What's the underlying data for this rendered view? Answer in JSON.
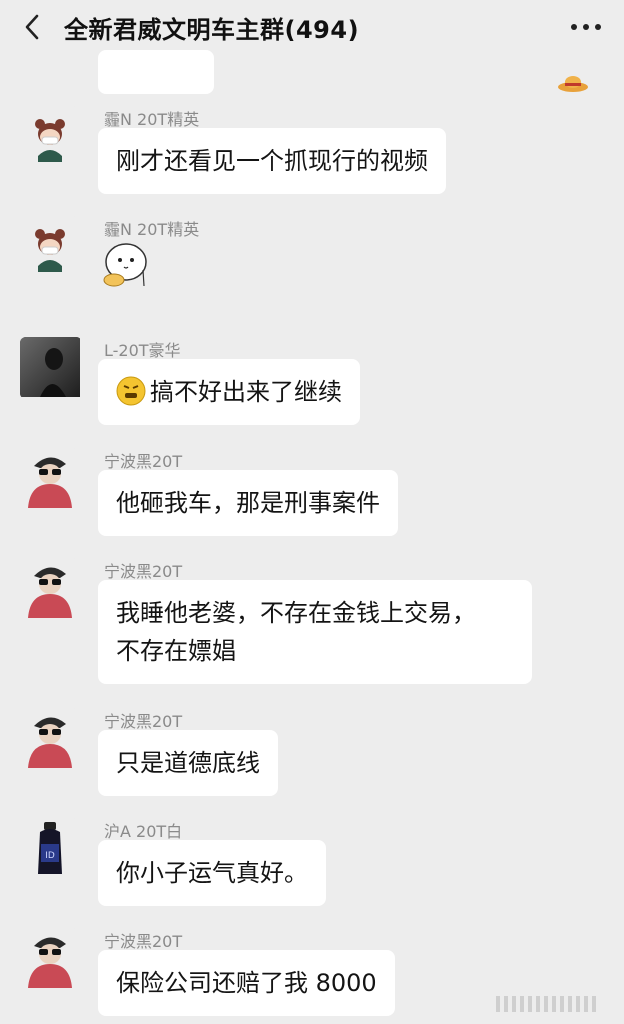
{
  "header": {
    "title": "全新君威文明车主群(494)",
    "back_icon": "chevron-left-icon",
    "more_icon": "more-dots-icon"
  },
  "messages": [
    {
      "sender": "霾N 20T精英",
      "text": "刚才还看见一个抓现行的视频",
      "avatar": "cartoon-girl-mask"
    },
    {
      "sender": "霾N 20T精英",
      "text": "",
      "sticker": "cute-blob-sticker",
      "avatar": "cartoon-girl-mask"
    },
    {
      "sender": "L-20T豪华",
      "text": "搞不好出来了继续",
      "emoji": "grimace-emoji",
      "avatar": "dark-portrait"
    },
    {
      "sender": "宁波黑20T",
      "text": "他砸我车，那是刑事案件",
      "avatar": "sunglasses-man"
    },
    {
      "sender": "宁波黑20T",
      "lines": [
        "我睡他老婆，不存在金钱上交易，",
        "不存在嫖娼"
      ],
      "avatar": "sunglasses-man"
    },
    {
      "sender": "宁波黑20T",
      "text": "只是道德底线",
      "avatar": "sunglasses-man"
    },
    {
      "sender": "沪A 20T白",
      "text": "你小子运气真好。",
      "avatar": "dark-bottle"
    },
    {
      "sender": "宁波黑20T",
      "text": "保险公司还赔了我 8000",
      "avatar": "sunglasses-man"
    }
  ],
  "colors": {
    "background": "#ededed",
    "bubble": "#ffffff",
    "sender_text": "#8a8a8a",
    "message_text": "#141414"
  }
}
